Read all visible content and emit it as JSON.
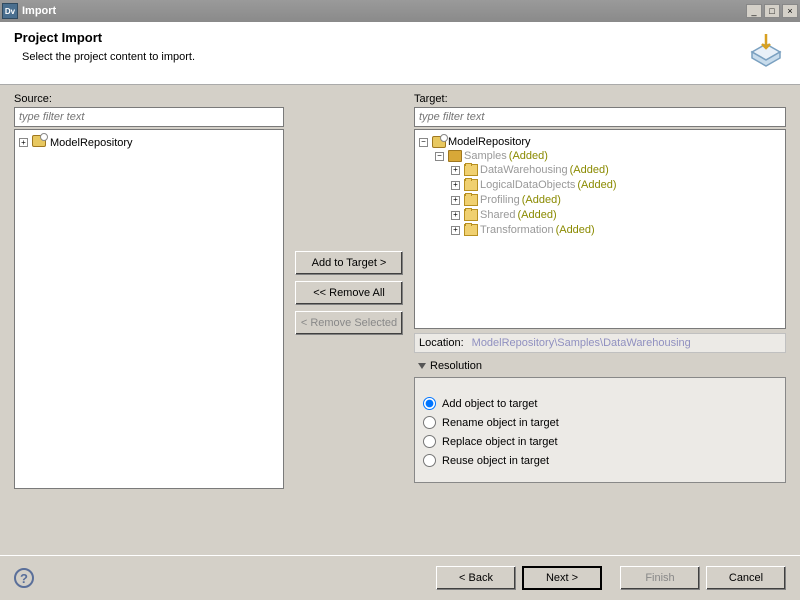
{
  "titlebar": {
    "app": "Dv",
    "title": "Import"
  },
  "header": {
    "title": "Project Import",
    "subtitle": "Select the project content to import."
  },
  "labels": {
    "source": "Source:",
    "target": "Target:",
    "filter_placeholder": "type filter text"
  },
  "source_tree": {
    "root": {
      "name": "ModelRepository"
    }
  },
  "target_tree": {
    "root": {
      "name": "ModelRepository",
      "children": [
        {
          "name": "Samples",
          "status": "(Added)",
          "children": [
            {
              "name": "DataWarehousing",
              "status": "(Added)"
            },
            {
              "name": "LogicalDataObjects",
              "status": "(Added)"
            },
            {
              "name": "Profiling",
              "status": "(Added)"
            },
            {
              "name": "Shared",
              "status": "(Added)"
            },
            {
              "name": "Transformation",
              "status": "(Added)"
            }
          ]
        }
      ]
    }
  },
  "middle_buttons": {
    "add": "Add to Target >",
    "remove_all": "<< Remove All",
    "remove_sel": "< Remove Selected"
  },
  "location": {
    "label": "Location:",
    "value": "ModelRepository\\Samples\\DataWarehousing"
  },
  "resolution": {
    "title": "Resolution",
    "options": {
      "add": "Add object to target",
      "rename": "Rename object in target",
      "replace": "Replace object in target",
      "reuse": "Reuse object in target"
    },
    "selected": "add"
  },
  "footer": {
    "back": "< Back",
    "next": "Next >",
    "finish": "Finish",
    "cancel": "Cancel"
  }
}
